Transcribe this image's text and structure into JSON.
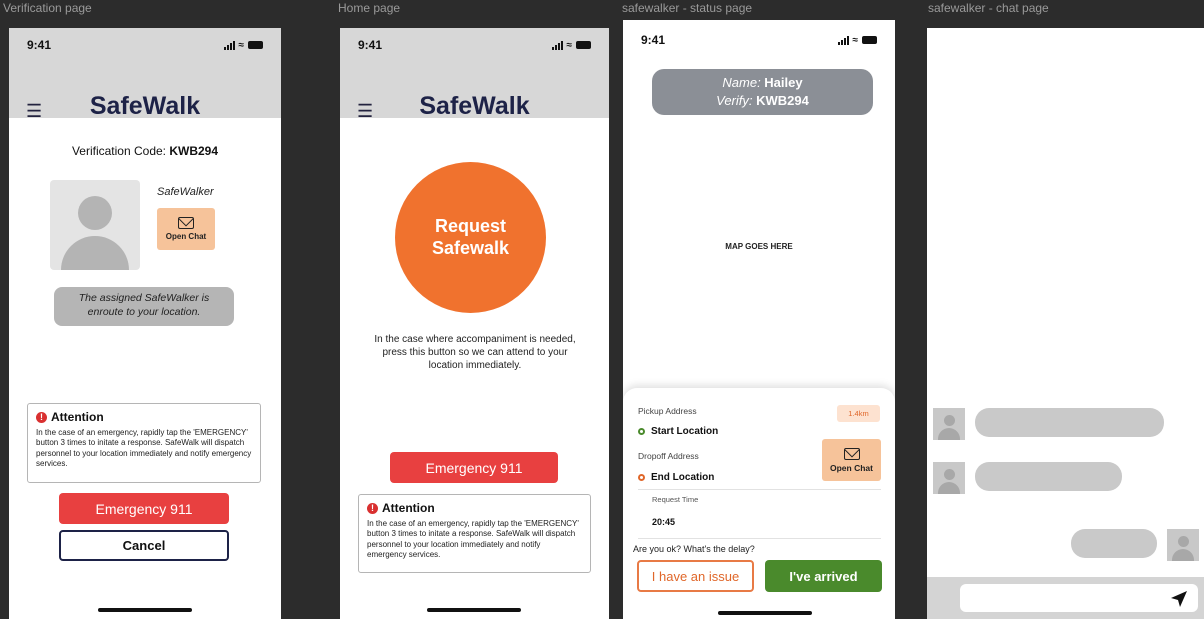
{
  "frames": {
    "verification": "Verification page",
    "home": "Home page",
    "status": "safewalker - status page",
    "chat": "safewalker - chat page"
  },
  "status_bar": {
    "time": "9:41"
  },
  "brand": "SafeWalk",
  "verification_page": {
    "code_label": "Verification Code: ",
    "code_value": "KWB294",
    "walker_label": "SafeWalker",
    "open_chat": "Open Chat",
    "message": "The assigned SafeWalker is enroute to your location.",
    "emergency_button": "Emergency 911",
    "cancel_button": "Cancel"
  },
  "attention": {
    "title": "Attention",
    "body": "In the case of an emergency, rapidly tap the 'EMERGENCY' button 3 times to initate a response. SafeWalk will dispatch personnel to your location immediately and notify emergency services."
  },
  "home_page": {
    "request_line1": "Request",
    "request_line2": "Safewalk",
    "description": "In the case where accompaniment is needed, press this button so we can attend to your location immediately.",
    "emergency_button": "Emergency 911"
  },
  "status_page": {
    "name_label": "Name: ",
    "name_value": "Hailey",
    "verify_label": "Verify: ",
    "verify_value": "KWB294",
    "map_placeholder": "MAP GOES HERE",
    "pickup_label": "Pickup Address",
    "distance": "1.4km",
    "start_location": "Start Location",
    "dropoff_label": "Dropoff Address",
    "end_location": "End Location",
    "open_chat": "Open Chat",
    "request_time_label": "Request Time",
    "request_time_value": "20:45",
    "prompt": "Are you ok? What's the delay?",
    "issue_button": "I have an issue",
    "arrived_button": "I've arrived"
  },
  "colors": {
    "brand_navy": "#1d2247",
    "request_orange": "#f0722e",
    "emergency_red": "#e84040",
    "arrived_green": "#4a8a2c",
    "chat_peach": "#f6c39a"
  },
  "icons": [
    "menu-icon",
    "envelope-icon",
    "alert-icon",
    "send-icon",
    "avatar-icon"
  ]
}
